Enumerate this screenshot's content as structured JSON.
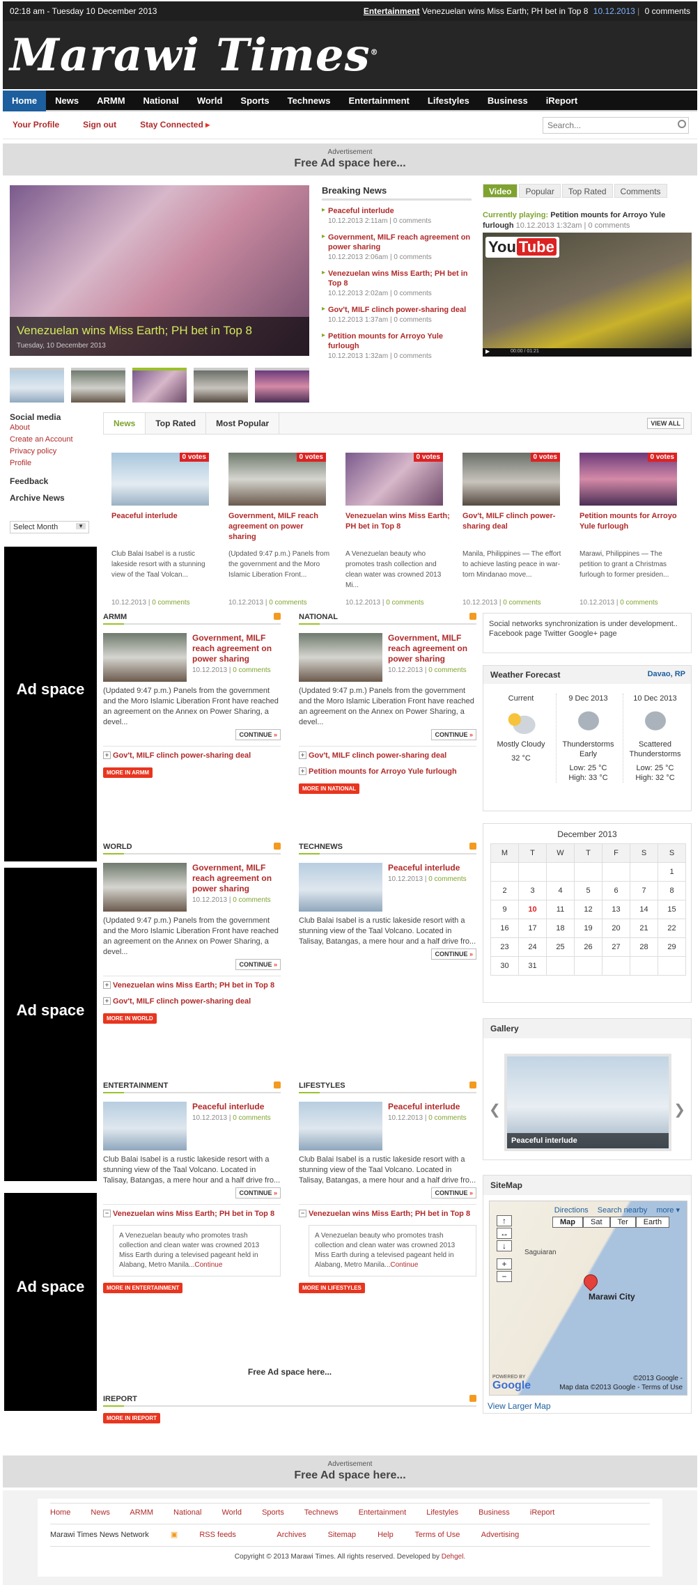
{
  "topbar": {
    "datetime": "02:18 am - Tuesday 10 December 2013",
    "ticker_category": "Entertainment",
    "ticker_title": "Venezuelan wins Miss Earth; PH bet in Top 8",
    "ticker_date": "10.12.2013",
    "ticker_comments": "0 comments"
  },
  "brand": {
    "name": "Marawi Times",
    "reg": "®"
  },
  "nav": {
    "items": [
      "Home",
      "News",
      "ARMM",
      "National",
      "World",
      "Sports",
      "Technews",
      "Entertainment",
      "Lifestyles",
      "Business",
      "iReport"
    ]
  },
  "subnav": {
    "profile": "Your Profile",
    "signout": "Sign out",
    "connected": "Stay Connected",
    "search_placeholder": "Search..."
  },
  "ad_banner": {
    "label": "Advertisement",
    "text": "Free Ad space here..."
  },
  "hero": {
    "title": "Venezuelan wins Miss Earth; PH bet in Top 8",
    "date": "Tuesday, 10 December 2013"
  },
  "breaking": {
    "title": "Breaking News",
    "items": [
      {
        "title": "Peaceful interlude",
        "date": "10.12.2013 2:11am",
        "comments": "0 comments"
      },
      {
        "title": "Government, MILF reach agreement on power sharing",
        "date": "10.12.2013 2:06am",
        "comments": "0 comments"
      },
      {
        "title": "Venezuelan wins Miss Earth; PH bet in Top 8",
        "date": "10.12.2013 2:02am",
        "comments": "0 comments"
      },
      {
        "title": "Gov't, MILF clinch power-sharing deal",
        "date": "10.12.2013 1:37am",
        "comments": "0 comments"
      },
      {
        "title": "Petition mounts for Arroyo Yule furlough",
        "date": "10.12.2013 1:32am",
        "comments": "0 comments"
      }
    ]
  },
  "video": {
    "tabs": [
      "Video",
      "Popular",
      "Top Rated",
      "Comments"
    ],
    "playing_label": "Currently playing:",
    "playing_title": "Petition mounts for Arroyo Yule furlough",
    "playing_meta": "10.12.2013 1:32am | 0 comments",
    "logo_you": "You",
    "logo_tube": "Tube",
    "time": "00:00 / 01:21"
  },
  "sidebar": {
    "social": "Social media",
    "links": [
      "About",
      "Create an Account",
      "Privacy policy",
      "Profile"
    ],
    "feedback": "Feedback",
    "archive": "Archive News",
    "select": "Select Month",
    "ad": "Ad space"
  },
  "newstabs": {
    "tabs": [
      "News",
      "Top Rated",
      "Most Popular"
    ],
    "viewall": "VIEW ALL",
    "cards": [
      {
        "votes": "0 votes",
        "title": "Peaceful interlude",
        "desc": "Club Balai Isabel is a rustic lakeside resort with a stunning view of the Taal Volcan...",
        "date": "10.12.2013",
        "comments": "0 comments"
      },
      {
        "votes": "0 votes",
        "title": "Government, MILF reach agreement on power sharing",
        "desc": "(Updated 9:47 p.m.) Panels from the government and the Moro Islamic Liberation Front...",
        "date": "10.12.2013",
        "comments": "0 comments"
      },
      {
        "votes": "0 votes",
        "title": "Venezuelan wins Miss Earth; PH bet in Top 8",
        "desc": "A Venezuelan beauty who promotes trash collection and clean water was crowned 2013 Mi...",
        "date": "10.12.2013",
        "comments": "0 comments"
      },
      {
        "votes": "0 votes",
        "title": "Gov't, MILF clinch power-sharing deal",
        "desc": "Manila, Philippines — The effort to achieve lasting peace in war-torn Mindanao move...",
        "date": "10.12.2013",
        "comments": "0 comments"
      },
      {
        "votes": "0 votes",
        "title": "Petition mounts for Arroyo Yule furlough",
        "desc": "Marawi, Philippines — The petition to grant a Christmas furlough to former presiden...",
        "date": "10.12.2013",
        "comments": "0 comments"
      }
    ]
  },
  "sections": {
    "continue": "CONTINUE",
    "armm": {
      "title": "ARMM",
      "story": "Government, MILF reach agreement on power sharing",
      "date": "10.12.2013",
      "comments": "0 comments",
      "desc": "(Updated 9:47 p.m.) Panels from the government and the Moro Islamic Liberation Front have reached an agreement on the Annex on Power Sharing, a devel...",
      "rel": [
        "Gov't, MILF clinch power-sharing deal"
      ],
      "more": "MORE IN ARMM"
    },
    "national": {
      "title": "NATIONAL",
      "story": "Government, MILF reach agreement on power sharing",
      "date": "10.12.2013",
      "comments": "0 comments",
      "desc": "(Updated 9:47 p.m.) Panels from the government and the Moro Islamic Liberation Front have reached an agreement on the Annex on Power Sharing, a devel...",
      "rel": [
        "Gov't, MILF clinch power-sharing deal",
        "Petition mounts for Arroyo Yule furlough"
      ],
      "more": "MORE IN NATIONAL"
    },
    "world": {
      "title": "WORLD",
      "story": "Government, MILF reach agreement on power sharing",
      "date": "10.12.2013",
      "comments": "0 comments",
      "desc": "(Updated 9:47 p.m.) Panels from the government and the Moro Islamic Liberation Front have reached an agreement on the Annex on Power Sharing, a devel...",
      "rel": [
        "Venezuelan wins Miss Earth; PH bet in Top 8",
        "Gov't, MILF clinch power-sharing deal"
      ],
      "more": "MORE IN WORLD"
    },
    "technews": {
      "title": "TECHNEWS",
      "story": "Peaceful interlude",
      "date": "10.12.2013",
      "comments": "0 comments",
      "desc": "Club Balai Isabel is a rustic lakeside resort with a stunning view of the Taal Volcano. Located in Talisay, Batangas, a mere hour and a half drive fro..."
    },
    "entertainment": {
      "title": "ENTERTAINMENT",
      "story": "Peaceful interlude",
      "date": "10.12.2013",
      "comments": "0 comments",
      "desc": "Club Balai Isabel is a rustic lakeside resort with a stunning view of the Taal Volcano. Located in Talisay, Batangas, a mere hour and a half drive fro...",
      "rel": "Venezuelan wins Miss Earth; PH bet in Top 8",
      "quote": "A Venezuelan beauty who promotes trash collection and clean water was crowned 2013 Miss Earth during a televised pageant held in Alabang, Metro Manila...",
      "quote_link": "Continue",
      "more": "MORE IN ENTERTAINMENT"
    },
    "lifestyles": {
      "title": "LIFESTYLES",
      "story": "Peaceful interlude",
      "date": "10.12.2013",
      "comments": "0 comments",
      "desc": "Club Balai Isabel is a rustic lakeside resort with a stunning view of the Taal Volcano. Located in Talisay, Batangas, a mere hour and a half drive fro...",
      "rel": "Venezuelan wins Miss Earth; PH bet in Top 8",
      "quote": "A Venezuelan beauty who promotes trash collection and clean water was crowned 2013 Miss Earth during a televised pageant held in Alabang, Metro Manila...",
      "quote_link": "Continue",
      "more": "MORE IN LIFESTYLES"
    },
    "freead": "Free Ad space here...",
    "ireport": {
      "title": "IREPORT",
      "more": "MORE IN IREPORT"
    }
  },
  "social_box": {
    "text": "Social networks synchronization is under development..",
    "links": "Facebook page Twitter Google+ page"
  },
  "weather": {
    "title": "Weather Forecast",
    "location": "Davao, RP",
    "cols": [
      {
        "day": "Current",
        "cond": "Mostly Cloudy",
        "temp": "32 °C"
      },
      {
        "day": "9 Dec 2013",
        "cond": "Thunderstorms Early",
        "low": "Low: 25 °C",
        "high": "High: 33 °C"
      },
      {
        "day": "10 Dec 2013",
        "cond": "Scattered Thunderstorms",
        "low": "Low: 25 °C",
        "high": "High: 32 °C"
      }
    ]
  },
  "calendar": {
    "title": "December 2013",
    "days": [
      "M",
      "T",
      "W",
      "T",
      "F",
      "S",
      "S"
    ],
    "weeks": [
      [
        "",
        "",
        "",
        "",
        "",
        "",
        "1"
      ],
      [
        "2",
        "3",
        "4",
        "5",
        "6",
        "7",
        "8"
      ],
      [
        "9",
        "10",
        "11",
        "12",
        "13",
        "14",
        "15"
      ],
      [
        "16",
        "17",
        "18",
        "19",
        "20",
        "21",
        "22"
      ],
      [
        "23",
        "24",
        "25",
        "26",
        "27",
        "28",
        "29"
      ],
      [
        "30",
        "31",
        "",
        "",
        "",
        "",
        ""
      ]
    ],
    "today": "10"
  },
  "gallery": {
    "title": "Gallery",
    "caption": "Peaceful interlude"
  },
  "sitemap": {
    "title": "SiteMap",
    "links": [
      "Directions",
      "Search nearby",
      "more ▾"
    ],
    "modes": [
      "Map",
      "Sat",
      "Ter",
      "Earth"
    ],
    "place": "Saguiaran",
    "city": "Marawi City",
    "powered": "POWERED BY",
    "google": "Google",
    "copy1": "©2013 Google -",
    "copy2": "Map data ©2013 Google - Terms of Use",
    "viewlarger": "View Larger Map"
  },
  "footer": {
    "nav": [
      "Home",
      "News",
      "ARMM",
      "National",
      "World",
      "Sports",
      "Technews",
      "Entertainment",
      "Lifestyles",
      "Business",
      "iReport"
    ],
    "network": "Marawi Times News Network",
    "links": [
      "RSS feeds",
      "Archives",
      "Sitemap",
      "Help",
      "Terms of Use",
      "Advertising"
    ],
    "copyright": "Copyright © 2013 Marawi Times. All rights reserved. Developed by",
    "dev": "Dehgel."
  }
}
